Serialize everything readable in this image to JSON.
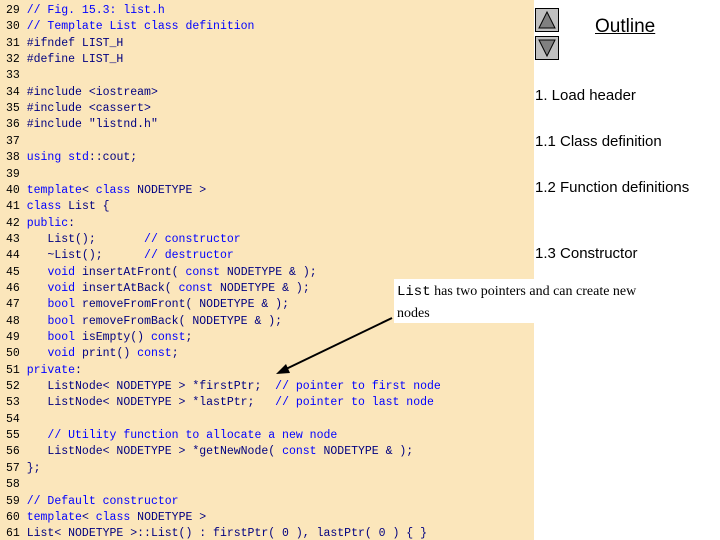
{
  "code": [
    {
      "n": "29",
      "parts": [
        {
          "t": "// Fig. 15.3: list.h",
          "c": "cm"
        }
      ]
    },
    {
      "n": "30",
      "parts": [
        {
          "t": "// Template List class definition",
          "c": "cm"
        }
      ]
    },
    {
      "n": "31",
      "parts": [
        {
          "t": "#ifndef LIST_H",
          "c": "tx"
        }
      ]
    },
    {
      "n": "32",
      "parts": [
        {
          "t": "#define LIST_H",
          "c": "tx"
        }
      ]
    },
    {
      "n": "33",
      "parts": []
    },
    {
      "n": "34",
      "parts": [
        {
          "t": "#include <iostream>",
          "c": "tx"
        }
      ]
    },
    {
      "n": "35",
      "parts": [
        {
          "t": "#include <cassert>",
          "c": "tx"
        }
      ]
    },
    {
      "n": "36",
      "parts": [
        {
          "t": "#include \"listnd.h\"",
          "c": "tx"
        }
      ]
    },
    {
      "n": "37",
      "parts": []
    },
    {
      "n": "38",
      "parts": [
        {
          "t": "using ",
          "c": "kw"
        },
        {
          "t": "std",
          "c": "kw"
        },
        {
          "t": "::cout;",
          "c": "tx"
        }
      ]
    },
    {
      "n": "39",
      "parts": []
    },
    {
      "n": "40",
      "parts": [
        {
          "t": "template",
          "c": "kw"
        },
        {
          "t": "< ",
          "c": "tx"
        },
        {
          "t": "class ",
          "c": "kw"
        },
        {
          "t": "NODETYPE >",
          "c": "tx"
        }
      ]
    },
    {
      "n": "41",
      "parts": [
        {
          "t": "class ",
          "c": "kw"
        },
        {
          "t": "List {",
          "c": "tx"
        }
      ]
    },
    {
      "n": "42",
      "parts": [
        {
          "t": "public",
          "c": "kw"
        },
        {
          "t": ":",
          "c": "tx"
        }
      ]
    },
    {
      "n": "43",
      "parts": [
        {
          "t": "   List();       ",
          "c": "tx"
        },
        {
          "t": "// constructor",
          "c": "cm"
        }
      ]
    },
    {
      "n": "44",
      "parts": [
        {
          "t": "   ~List();      ",
          "c": "tx"
        },
        {
          "t": "// destructor",
          "c": "cm"
        }
      ]
    },
    {
      "n": "45",
      "parts": [
        {
          "t": "   ",
          "c": "tx"
        },
        {
          "t": "void ",
          "c": "kw"
        },
        {
          "t": "insertAtFront( ",
          "c": "tx"
        },
        {
          "t": "const ",
          "c": "kw"
        },
        {
          "t": "NODETYPE & );",
          "c": "tx"
        }
      ]
    },
    {
      "n": "46",
      "parts": [
        {
          "t": "   ",
          "c": "tx"
        },
        {
          "t": "void ",
          "c": "kw"
        },
        {
          "t": "insertAtBack( ",
          "c": "tx"
        },
        {
          "t": "const ",
          "c": "kw"
        },
        {
          "t": "NODETYPE & );",
          "c": "tx"
        }
      ]
    },
    {
      "n": "47",
      "parts": [
        {
          "t": "   ",
          "c": "tx"
        },
        {
          "t": "bool ",
          "c": "kw"
        },
        {
          "t": "removeFromFront( NODETYPE & );",
          "c": "tx"
        }
      ]
    },
    {
      "n": "48",
      "parts": [
        {
          "t": "   ",
          "c": "tx"
        },
        {
          "t": "bool ",
          "c": "kw"
        },
        {
          "t": "removeFromBack( NODETYPE & );",
          "c": "tx"
        }
      ]
    },
    {
      "n": "49",
      "parts": [
        {
          "t": "   ",
          "c": "tx"
        },
        {
          "t": "bool ",
          "c": "kw"
        },
        {
          "t": "isEmpty() ",
          "c": "tx"
        },
        {
          "t": "const",
          "c": "kw"
        },
        {
          "t": ";",
          "c": "tx"
        }
      ]
    },
    {
      "n": "50",
      "parts": [
        {
          "t": "   ",
          "c": "tx"
        },
        {
          "t": "void ",
          "c": "kw"
        },
        {
          "t": "print() ",
          "c": "tx"
        },
        {
          "t": "const",
          "c": "kw"
        },
        {
          "t": ";",
          "c": "tx"
        }
      ]
    },
    {
      "n": "51",
      "parts": [
        {
          "t": "private",
          "c": "kw"
        },
        {
          "t": ":",
          "c": "tx"
        }
      ]
    },
    {
      "n": "52",
      "parts": [
        {
          "t": "   ListNode< NODETYPE > *firstPtr;  ",
          "c": "tx"
        },
        {
          "t": "// pointer to first node",
          "c": "cm"
        }
      ]
    },
    {
      "n": "53",
      "parts": [
        {
          "t": "   ListNode< NODETYPE > *lastPtr;   ",
          "c": "tx"
        },
        {
          "t": "// pointer to last node",
          "c": "cm"
        }
      ]
    },
    {
      "n": "54",
      "parts": []
    },
    {
      "n": "55",
      "parts": [
        {
          "t": "   // Utility function to allocate a new node",
          "c": "cm"
        }
      ]
    },
    {
      "n": "56",
      "parts": [
        {
          "t": "   ListNode< NODETYPE > *getNewNode( ",
          "c": "tx"
        },
        {
          "t": "const ",
          "c": "kw"
        },
        {
          "t": "NODETYPE & );",
          "c": "tx"
        }
      ]
    },
    {
      "n": "57",
      "parts": [
        {
          "t": "};",
          "c": "tx"
        }
      ]
    },
    {
      "n": "58",
      "parts": []
    },
    {
      "n": "59",
      "parts": [
        {
          "t": "// Default constructor",
          "c": "cm"
        }
      ]
    },
    {
      "n": "60",
      "parts": [
        {
          "t": "template",
          "c": "kw"
        },
        {
          "t": "< ",
          "c": "tx"
        },
        {
          "t": "class ",
          "c": "kw"
        },
        {
          "t": "NODETYPE >",
          "c": "tx"
        }
      ]
    },
    {
      "n": "61",
      "parts": [
        {
          "t": "List< NODETYPE >::List() : firstPtr( 0 ), lastPtr( 0 ) { }",
          "c": "tx"
        }
      ]
    }
  ],
  "outline": {
    "title": "Outline",
    "up_icon": "triangle-up",
    "down_icon": "triangle-down",
    "items": [
      "1. Load header",
      "1.1 Class definition",
      "1.2 Function definitions",
      "1.3 Constructor"
    ]
  },
  "callout": {
    "mono": "List",
    "text": " has two pointers and can create new nodes"
  },
  "colors": {
    "code_bg": "#fbe6bb",
    "code_text": "#000080",
    "keyword": "#0000ff",
    "comment": "#0000ff"
  }
}
